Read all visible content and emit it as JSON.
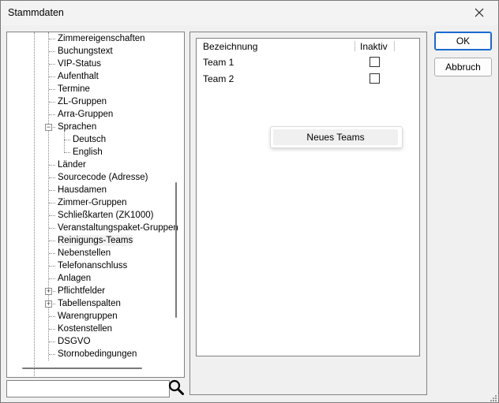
{
  "window": {
    "title": "Stammdaten"
  },
  "tree": {
    "items": [
      {
        "label": "Zimmereigenschaften"
      },
      {
        "label": "Buchungstext"
      },
      {
        "label": "VIP-Status"
      },
      {
        "label": "Aufenthalt"
      },
      {
        "label": "Termine"
      },
      {
        "label": "ZL-Gruppen"
      },
      {
        "label": "Arra-Gruppen"
      },
      {
        "label": "Sprachen",
        "expander": "−"
      },
      {
        "label": "Deutsch"
      },
      {
        "label": "English"
      },
      {
        "label": "Länder"
      },
      {
        "label": "Sourcecode (Adresse)"
      },
      {
        "label": "Hausdamen"
      },
      {
        "label": "Zimmer-Gruppen"
      },
      {
        "label": "Schließkarten (ZK1000)"
      },
      {
        "label": "Veranstaltungspaket-Gruppen"
      },
      {
        "label": "Reinigungs-Teams",
        "selected": true
      },
      {
        "label": "Nebenstellen"
      },
      {
        "label": "Telefonanschluss"
      },
      {
        "label": "Anlagen"
      },
      {
        "label": "Pflichtfelder",
        "expander": "+"
      },
      {
        "label": "Tabellenspalten",
        "expander": "+"
      },
      {
        "label": "Warengruppen"
      },
      {
        "label": "Kostenstellen"
      },
      {
        "label": "DSGVO"
      },
      {
        "label": "Stornobedingungen"
      }
    ]
  },
  "search": {
    "value": "",
    "icon": "search-icon"
  },
  "list": {
    "columns": [
      "Bezeichnung",
      "Inaktiv"
    ],
    "rows": [
      {
        "name": "Team 1",
        "inaktiv": false
      },
      {
        "name": "Team 2",
        "inaktiv": false
      }
    ]
  },
  "context_menu": {
    "items": [
      "Neues Teams"
    ]
  },
  "buttons": {
    "ok": "OK",
    "cancel": "Abbruch"
  }
}
